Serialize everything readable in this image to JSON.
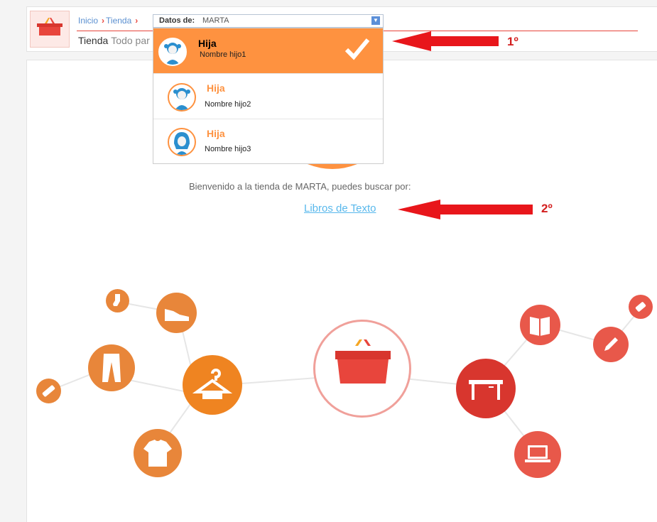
{
  "breadcrumb": [
    "Inicio",
    "Tienda"
  ],
  "header": {
    "section": "Tienda",
    "subtitle": "Todo par"
  },
  "selector": {
    "label": "Datos de:",
    "value": "MARTA"
  },
  "children": [
    {
      "role": "Hija",
      "name": "Nombre hijo1",
      "selected": true
    },
    {
      "role": "Hija",
      "name": "Nombre hijo2",
      "selected": false
    },
    {
      "role": "Hija",
      "name": "Nombre hijo3",
      "selected": false
    }
  ],
  "welcome": "Bienvenido a la tienda de MARTA, puedes buscar por:",
  "link": "Libros de Texto",
  "annotations": [
    "1º",
    "2º"
  ],
  "colors": {
    "accent": "#fe9240",
    "red": "#e8453c",
    "link": "#58b8ec",
    "annotation": "#d31f1f"
  },
  "icons": [
    "basket-icon",
    "hanger-icon",
    "pants-icon",
    "tshirt-icon",
    "sneaker-icon",
    "sock-icon",
    "badge-icon",
    "table-icon",
    "book-icon",
    "pencil-icon",
    "eraser-icon",
    "laptop-icon"
  ]
}
